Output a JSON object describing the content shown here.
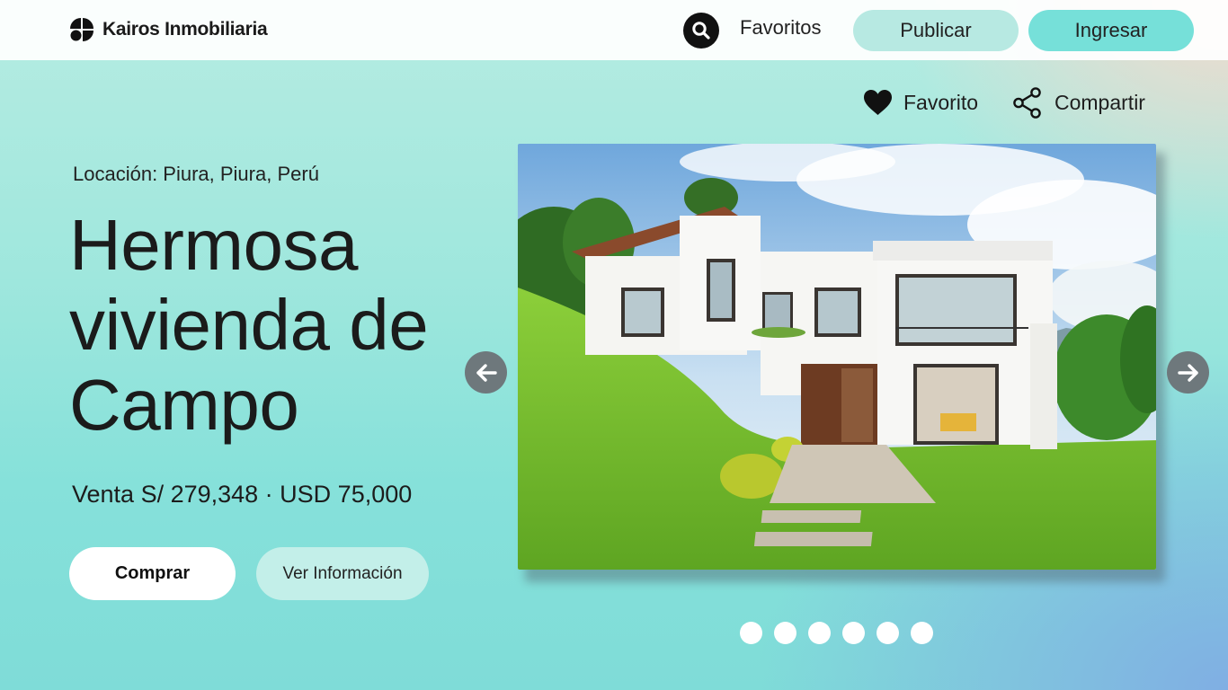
{
  "header": {
    "brand_name": "Kairos Inmobiliaria",
    "nav_favoritos": "Favoritos",
    "publicar_label": "Publicar",
    "ingresar_label": "Ingresar"
  },
  "actions": {
    "favorito_label": "Favorito",
    "compartir_label": "Compartir"
  },
  "listing": {
    "location": "Locación: Piura, Piura, Perú",
    "title_lines": [
      "Hermosa",
      "vivienda de",
      "Campo"
    ],
    "price": "Venta S/ 279,348 · USD 75,000",
    "buy_label": "Comprar",
    "info_label": "Ver Información"
  },
  "gallery": {
    "image": "country-house-photo",
    "slide_count": 6
  },
  "icons": {
    "brand": "brand-logo-icon",
    "search": "search-icon",
    "heart": "heart-icon",
    "share": "share-icon",
    "prev": "arrow-left-icon",
    "next": "arrow-right-icon"
  },
  "colors": {
    "publicar_bg": "#b7e9e2",
    "ingresar_bg": "#76e0d9",
    "arrow_bg": "#6e787c"
  }
}
